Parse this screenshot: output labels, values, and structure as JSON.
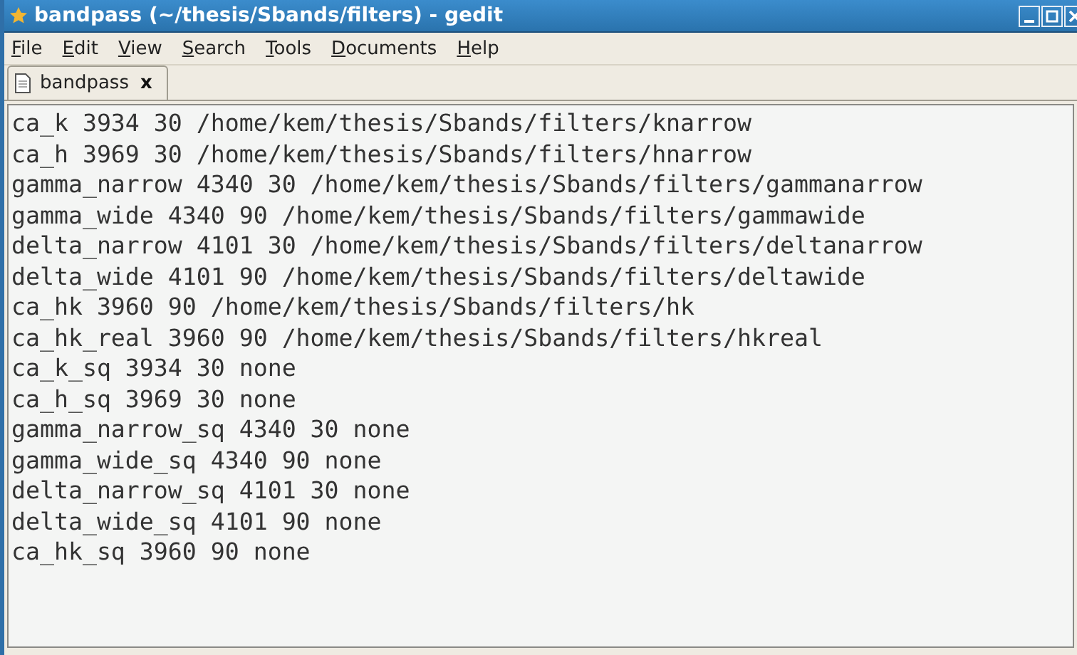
{
  "window": {
    "title": "bandpass (~/thesis/Sbands/filters) - gedit"
  },
  "menu": [
    "File",
    "Edit",
    "View",
    "Search",
    "Tools",
    "Documents",
    "Help"
  ],
  "tabs": [
    {
      "label": "bandpass",
      "selected": true,
      "close": "x"
    }
  ],
  "lines": [
    "ca_k 3934 30 /home/kem/thesis/Sbands/filters/knarrow",
    "ca_h 3969 30 /home/kem/thesis/Sbands/filters/hnarrow",
    "gamma_narrow 4340 30 /home/kem/thesis/Sbands/filters/gammanarrow",
    "gamma_wide 4340 90 /home/kem/thesis/Sbands/filters/gammawide",
    "delta_narrow 4101 30 /home/kem/thesis/Sbands/filters/deltanarrow",
    "delta_wide 4101 90 /home/kem/thesis/Sbands/filters/deltawide",
    "ca_hk 3960 90 /home/kem/thesis/Sbands/filters/hk",
    "ca_hk_real 3960 90 /home/kem/thesis/Sbands/filters/hkreal",
    "ca_k_sq 3934 30 none",
    "ca_h_sq 3969 30 none",
    "gamma_narrow_sq 4340 30 none",
    "gamma_wide_sq 4340 90 none",
    "delta_narrow_sq 4101 30 none",
    "delta_wide_sq 4101 90 none",
    "ca_hk_sq 3960 90 none"
  ]
}
